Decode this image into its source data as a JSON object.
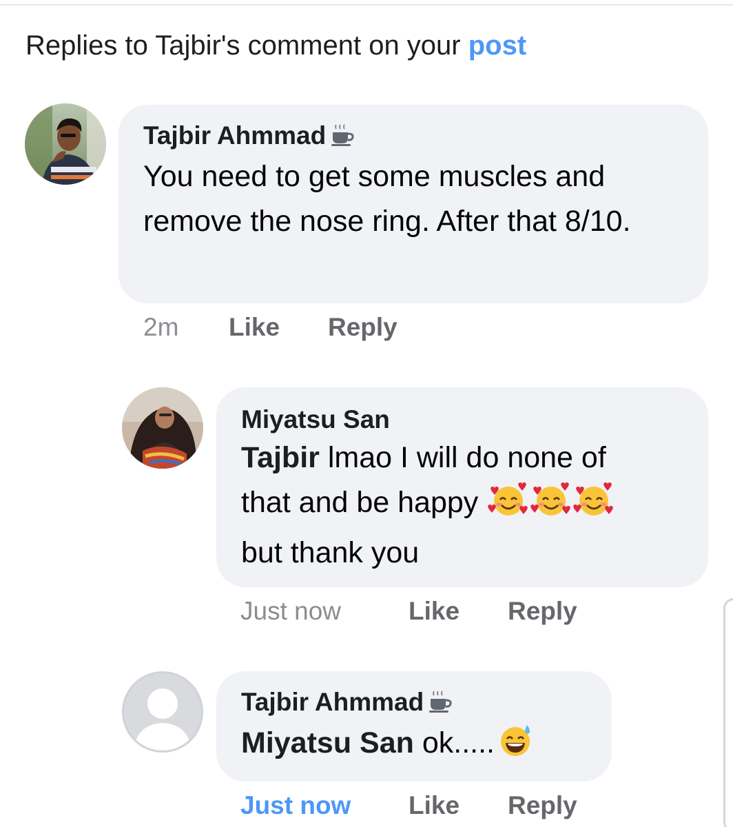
{
  "header": {
    "prefix": "Replies to Tajbir's comment on your",
    "link": "post"
  },
  "comments": [
    {
      "author": "Tajbir Ahmmad",
      "badge_icon": "coffee-cup-icon",
      "text": "You need to get some muscles and remove the nose ring. After that 8/10.",
      "time": "2m",
      "like": "Like",
      "reply": "Reply"
    },
    {
      "author": "Miyatsu San",
      "mention": "Tajbir",
      "text_line1": " lmao I will do none of",
      "text_line2": "that and be happy",
      "text_line3": "but thank you",
      "emojis": [
        "smiling-face-with-hearts-icon",
        "smiling-face-with-hearts-icon",
        "smiling-face-with-hearts-icon"
      ],
      "time": "Just now",
      "like": "Like",
      "reply": "Reply"
    },
    {
      "author": "Tajbir Ahmmad",
      "badge_icon": "coffee-cup-icon",
      "mention": "Miyatsu San",
      "text": " ok.....",
      "emoji": "grinning-face-with-sweat-icon",
      "time": "Just now",
      "like": "Like",
      "reply": "Reply"
    }
  ],
  "colors": {
    "link_blue": "#4d97f8",
    "bubble_bg": "#f0f2f5",
    "meta_gray": "#65676b",
    "time_gray": "#8a8d91"
  }
}
